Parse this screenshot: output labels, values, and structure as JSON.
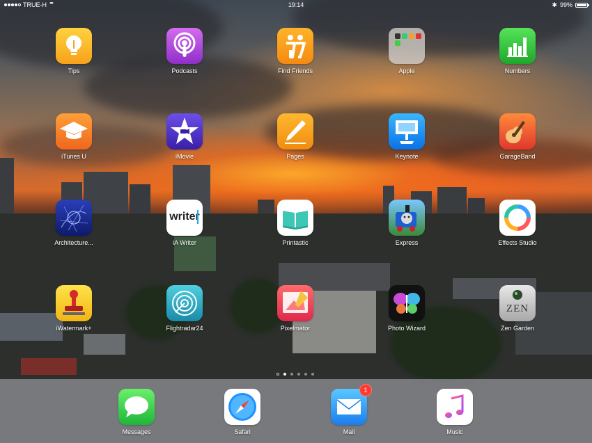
{
  "status_bar": {
    "carrier": "TRUE-H",
    "time": "19:14",
    "battery": "99%",
    "battery_level": 0.99
  },
  "home_grid": [
    {
      "label": "Tips",
      "icon": "lightbulb-icon"
    },
    {
      "label": "Podcasts",
      "icon": "podcasts-icon"
    },
    {
      "label": "Find Friends",
      "icon": "find-friends-icon"
    },
    {
      "label": "Apple",
      "icon": "folder-icon"
    },
    {
      "label": "Numbers",
      "icon": "numbers-chart-icon"
    },
    {
      "label": "iTunes U",
      "icon": "graduation-cap-icon"
    },
    {
      "label": "iMovie",
      "icon": "imovie-star-icon"
    },
    {
      "label": "Pages",
      "icon": "pen-icon"
    },
    {
      "label": "Keynote",
      "icon": "keynote-podium-icon"
    },
    {
      "label": "GarageBand",
      "icon": "guitar-icon"
    },
    {
      "label": "Architecture...",
      "icon": "blueprint-icon"
    },
    {
      "label": "iA Writer",
      "icon": "writer-icon",
      "icon_text": "writer"
    },
    {
      "label": "Printastic",
      "icon": "open-book-icon"
    },
    {
      "label": "Express",
      "icon": "train-icon"
    },
    {
      "label": "Effects Studio",
      "icon": "ring-icon"
    },
    {
      "label": "iWatermark+",
      "icon": "stamp-icon"
    },
    {
      "label": "Flightradar24",
      "icon": "radar-icon"
    },
    {
      "label": "Pixelmator",
      "icon": "pixelmator-brush-icon"
    },
    {
      "label": "Photo Wizard",
      "icon": "butterfly-icon"
    },
    {
      "label": "Zen Garden",
      "icon": "zen-icon",
      "icon_text": "ZEN"
    }
  ],
  "page_indicator": {
    "pages": 5,
    "current": 1
  },
  "dock": [
    {
      "label": "Messages",
      "icon": "speech-bubble-icon"
    },
    {
      "label": "Safari",
      "icon": "compass-icon"
    },
    {
      "label": "Mail",
      "icon": "envelope-icon",
      "badge": "1"
    },
    {
      "label": "Music",
      "icon": "music-note-icon"
    }
  ],
  "colors": {
    "badge": "#ff3b30",
    "label_text": "#ffffff"
  }
}
